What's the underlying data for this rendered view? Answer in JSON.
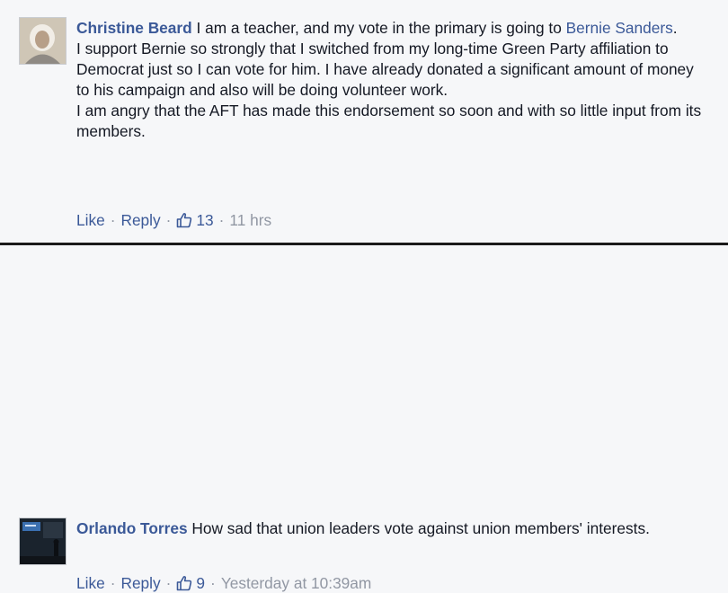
{
  "comments": [
    {
      "author": "Christine Beard",
      "intro": " I am a teacher, and my vote in the primary is going to ",
      "mention": "Bernie Sanders",
      "intro_end": ".",
      "paragraphs": [
        "I support Bernie so strongly that I switched from my long-time Green Party affiliation to Democrat just so I can vote for him. I have already donated a significant amount of money to his campaign and also will be doing volunteer work.",
        "I am angry that the AFT has made this endorsement so soon and with so little input from its members."
      ],
      "like_label": "Like",
      "reply_label": "Reply",
      "like_count": "13",
      "timestamp": "11 hrs"
    },
    {
      "author": "Orlando Torres",
      "text": " How sad that union leaders vote against union members' interests.",
      "like_label": "Like",
      "reply_label": "Reply",
      "like_count": "9",
      "timestamp": "Yesterday at 10:39am"
    }
  ],
  "separator": "·",
  "colors": {
    "link": "#3b5998",
    "meta": "#9197a3",
    "text": "#141823",
    "background": "#f6f7f9"
  },
  "icons": {
    "like_count_icon": "thumbs-up-icon"
  }
}
